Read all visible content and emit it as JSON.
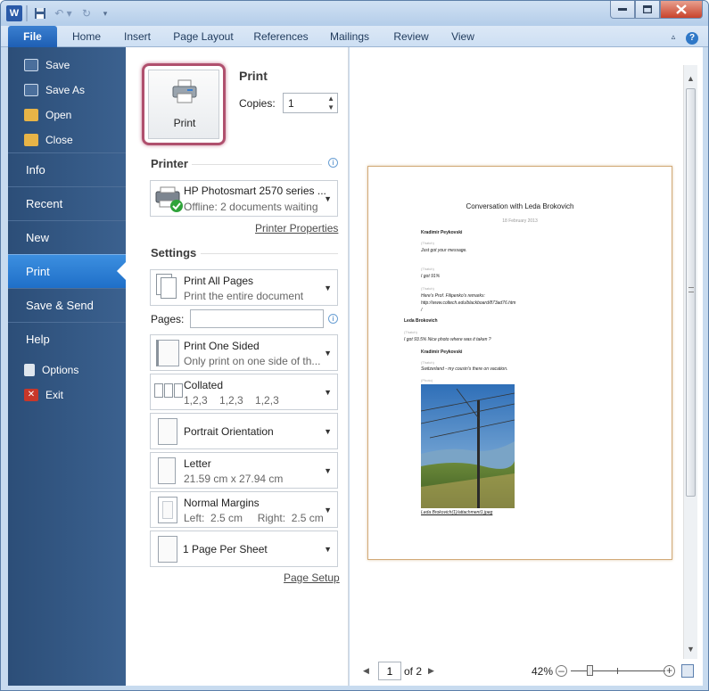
{
  "ribbon": {
    "file": "File",
    "tabs": [
      "Home",
      "Insert",
      "Page Layout",
      "References",
      "Mailings",
      "Review",
      "View"
    ]
  },
  "nav": {
    "save": "Save",
    "save_as": "Save As",
    "open": "Open",
    "close": "Close",
    "info": "Info",
    "recent": "Recent",
    "new": "New",
    "print": "Print",
    "save_send": "Save & Send",
    "help": "Help",
    "options": "Options",
    "exit": "Exit"
  },
  "print_panel": {
    "heading": "Print",
    "print_button": "Print",
    "copies_label": "Copies:",
    "copies_value": "1",
    "printer_heading": "Printer",
    "printer_name": "HP Photosmart 2570 series ...",
    "printer_status": "Offline: 2 documents waiting",
    "printer_properties": "Printer Properties",
    "settings_heading": "Settings",
    "pages_label": "Pages:",
    "pages_value": "",
    "page_setup": "Page Setup",
    "settings": [
      {
        "line1": "Print All Pages",
        "line2": "Print the entire document"
      },
      {
        "line1": "Print One Sided",
        "line2": "Only print on one side of th..."
      },
      {
        "line1": "Collated",
        "line2": "1,2,3    1,2,3    1,2,3"
      },
      {
        "line1": "Portrait Orientation",
        "line2": ""
      },
      {
        "line1": "Letter",
        "line2": "21.59 cm x 27.94 cm"
      },
      {
        "line1": "Normal Margins",
        "line2": "Left:  2.5 cm     Right:  2.5 cm"
      },
      {
        "line1": "1 Page Per Sheet",
        "line2": ""
      }
    ]
  },
  "preview": {
    "doc_title": "Conversation with Leda Brokovich",
    "doc_date": "18 February 2013",
    "lines": [
      "Kradimir  Peykovski",
      "(Thatch)",
      "Just got your message.",
      "(Thatch)",
      "I got 91%",
      "(Thatch)",
      "Here's Prof. Filipenko's  remarks:",
      "http://www.coltech.edu/blackboard/873ad76.htm",
      "/",
      "Leda Brokovich",
      "(Thatch)",
      "I got 93.5% Nice photo where was it taken ?",
      "Kradimir  Peykovski",
      "(Thatch)",
      "Switzerland  - my cousin's  there on vacation.",
      "(Photo)"
    ],
    "caption": "Leda Brokovich(1)/attachment1.jpeg",
    "current_page": "1",
    "of_pages": "of 2",
    "zoom": "42%"
  },
  "colors": {
    "nav_bg": "#2c4e78",
    "nav_selected": "#2a7cd6",
    "file_tab": "#2466bd",
    "print_button_ring": "#b0506e"
  }
}
